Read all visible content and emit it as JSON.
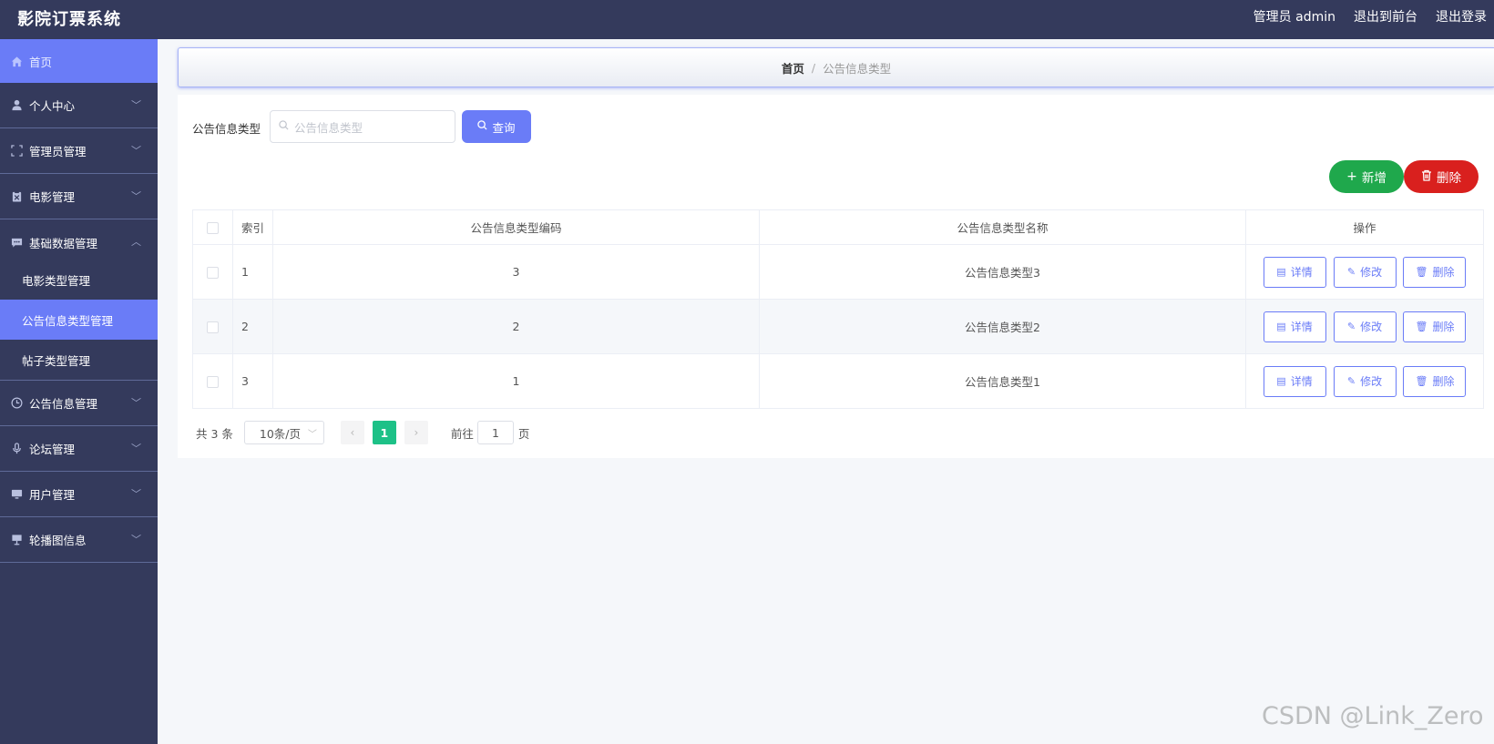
{
  "app": {
    "title": "影院订票系统"
  },
  "topbar": {
    "admin_label": "管理员 admin",
    "to_front": "退出到前台",
    "logout": "退出登录"
  },
  "sidebar": {
    "home": "首页",
    "items": [
      {
        "label": "个人中心",
        "icon": "user-icon",
        "expanded": false
      },
      {
        "label": "管理员管理",
        "icon": "scan-icon",
        "expanded": false
      },
      {
        "label": "电影管理",
        "icon": "clipboard-icon",
        "expanded": false
      },
      {
        "label": "基础数据管理",
        "icon": "chat-icon",
        "expanded": true,
        "children": [
          "电影类型管理",
          "公告信息类型管理",
          "帖子类型管理"
        ]
      },
      {
        "label": "公告信息管理",
        "icon": "clock-icon",
        "expanded": false
      },
      {
        "label": "论坛管理",
        "icon": "microphone-icon",
        "expanded": false
      },
      {
        "label": "用户管理",
        "icon": "monitor-icon",
        "expanded": false
      },
      {
        "label": "轮播图信息",
        "icon": "easel-icon",
        "expanded": false
      }
    ]
  },
  "breadcrumb": {
    "home": "首页",
    "separator": "/",
    "current": "公告信息类型"
  },
  "search": {
    "label": "公告信息类型",
    "placeholder": "公告信息类型",
    "button": "查询"
  },
  "actions": {
    "add": "新增",
    "delete": "删除"
  },
  "table": {
    "headers": {
      "index": "索引",
      "code": "公告信息类型编码",
      "name": "公告信息类型名称",
      "ops": "操作"
    },
    "rows": [
      {
        "index": "1",
        "code": "3",
        "name": "公告信息类型3"
      },
      {
        "index": "2",
        "code": "2",
        "name": "公告信息类型2"
      },
      {
        "index": "3",
        "code": "1",
        "name": "公告信息类型1"
      }
    ],
    "op_labels": {
      "detail": "详情",
      "edit": "修改",
      "delete": "删除"
    }
  },
  "pager": {
    "total": "共 3 条",
    "page_size": "10条/页",
    "current_page": "1",
    "goto_label": "前往",
    "goto_value": "1",
    "page_suffix": "页"
  },
  "watermark": "CSDN @Link_Zero",
  "colors": {
    "primary": "#6a7cf7",
    "sidebar": "#343a5c",
    "add": "#1fa84c",
    "danger": "#d9201e",
    "page_active": "#1dc187"
  }
}
